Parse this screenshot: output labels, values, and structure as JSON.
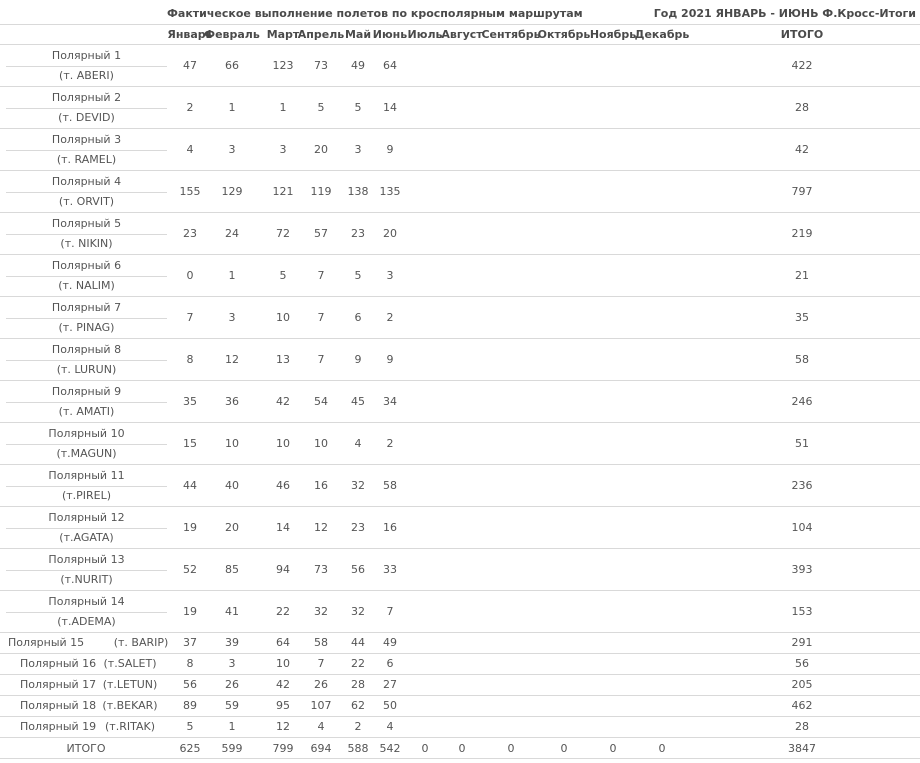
{
  "header": {
    "title": "Фактическое выполнение полетов по кросполярным маршрутам",
    "right": "Год 2021 ЯНВАРЬ - ИЮНЬ Ф.Кросс-Итоги"
  },
  "columns": [
    "Январь",
    "Февраль",
    "Март",
    "Апрель",
    "Май",
    "Июнь",
    "Июль",
    "Август",
    "Сентябрь",
    "Октябрь",
    "Ноябрь",
    "Декабрь",
    "ИТОГО"
  ],
  "rows_tall": [
    {
      "name": "Полярный 1",
      "code": "(т. ABERI)",
      "values": [
        "47",
        "66",
        "123",
        "73",
        "49",
        "64"
      ],
      "total": "422"
    },
    {
      "name": "Полярный 2",
      "code": "(т. DEVID)",
      "values": [
        "2",
        "1",
        "1",
        "5",
        "5",
        "14"
      ],
      "total": "28"
    },
    {
      "name": "Полярный 3",
      "code": "(т. RAMEL)",
      "values": [
        "4",
        "3",
        "3",
        "20",
        "3",
        "9"
      ],
      "total": "42"
    },
    {
      "name": "Полярный 4",
      "code": "(т. ORVIT)",
      "values": [
        "155",
        "129",
        "121",
        "119",
        "138",
        "135"
      ],
      "total": "797"
    },
    {
      "name": "Полярный 5",
      "code": "(т. NIKIN)",
      "values": [
        "23",
        "24",
        "72",
        "57",
        "23",
        "20"
      ],
      "total": "219"
    },
    {
      "name": "Полярный 6",
      "code": "(т. NALIM)",
      "values": [
        "0",
        "1",
        "5",
        "7",
        "5",
        "3"
      ],
      "total": "21"
    },
    {
      "name": "Полярный 7",
      "code": "(т. PINAG)",
      "values": [
        "7",
        "3",
        "10",
        "7",
        "6",
        "2"
      ],
      "total": "35"
    },
    {
      "name": "Полярный 8",
      "code": "(т. LURUN)",
      "values": [
        "8",
        "12",
        "13",
        "7",
        "9",
        "9"
      ],
      "total": "58"
    },
    {
      "name": "Полярный 9",
      "code": "(т. AMATI)",
      "values": [
        "35",
        "36",
        "42",
        "54",
        "45",
        "34"
      ],
      "total": "246"
    },
    {
      "name": "Полярный 10",
      "code": "(т.MAGUN)",
      "values": [
        "15",
        "10",
        "10",
        "10",
        "4",
        "2"
      ],
      "total": "51"
    },
    {
      "name": "Полярный 11",
      "code": "(т.PIREL)",
      "values": [
        "44",
        "40",
        "46",
        "16",
        "32",
        "58"
      ],
      "total": "236"
    },
    {
      "name": "Полярный 12",
      "code": "(т.AGATA)",
      "values": [
        "19",
        "20",
        "14",
        "12",
        "23",
        "16"
      ],
      "total": "104"
    },
    {
      "name": "Полярный 13",
      "code": "(т.NURIT)",
      "values": [
        "52",
        "85",
        "94",
        "73",
        "56",
        "33"
      ],
      "total": "393"
    },
    {
      "name": "Полярный 14",
      "code": "(т.ADEMA)",
      "values": [
        "19",
        "41",
        "22",
        "32",
        "32",
        "7"
      ],
      "total": "153"
    }
  ],
  "rows_short": [
    {
      "name": "Полярный 15",
      "code": "(т. BARIP)",
      "values": [
        "37",
        "39",
        "64",
        "58",
        "44",
        "49"
      ],
      "total": "291"
    },
    {
      "name": "Полярный 16",
      "code": "(т.SALET)",
      "values": [
        "8",
        "3",
        "10",
        "7",
        "22",
        "6"
      ],
      "total": "56"
    },
    {
      "name": "Полярный 17",
      "code": "(т.LETUN)",
      "values": [
        "56",
        "26",
        "42",
        "26",
        "28",
        "27"
      ],
      "total": "205"
    },
    {
      "name": "Полярный 18",
      "code": "(т.BEKAR)",
      "values": [
        "89",
        "59",
        "95",
        "107",
        "62",
        "50"
      ],
      "total": "462"
    },
    {
      "name": "Полярный 19",
      "code": "(т.RITAK)",
      "values": [
        "5",
        "1",
        "12",
        "4",
        "2",
        "4"
      ],
      "total": "28"
    }
  ],
  "totals": {
    "label": "ИТОГО",
    "values": [
      "625",
      "599",
      "799",
      "694",
      "588",
      "542",
      "0",
      "0",
      "0",
      "0",
      "0",
      "0"
    ],
    "total": "3847"
  }
}
